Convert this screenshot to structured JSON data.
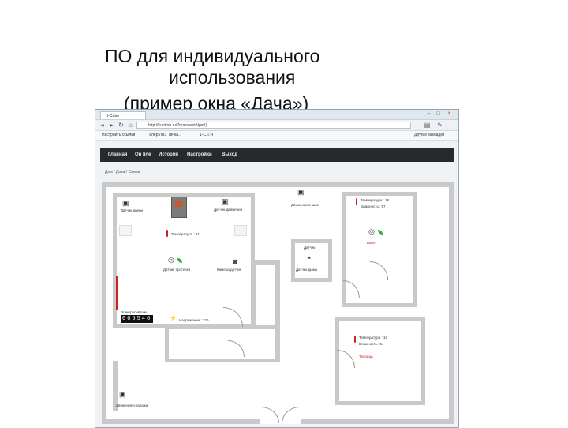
{
  "slide": {
    "title_line1": "ПО для индивидуального",
    "title_line2": "использования",
    "title_line3": "(пример окна «Дача»)"
  },
  "browser": {
    "tab_title": "I-Cube",
    "url": "http://kubtron.ru/?main=ext&lp=1)",
    "bookmarks": [
      "Настроить ссылки",
      "Гипер ЛВЗ Тачка...",
      "1-С.Т.Я"
    ],
    "other_bookmarks": "Другие закладки"
  },
  "menu": {
    "items": [
      "Главная",
      "On line",
      "История",
      "Настройки",
      "Выход"
    ]
  },
  "breadcrumb": "Дом / Дача / Схема",
  "plan": {
    "labels": {
      "sensor_door_left": "Датчик двери",
      "sensor_motion_top": "Датчик движения",
      "motion_sensor_hall": "Движение в зале",
      "temp_main": "Температура : 21",
      "temp_right_top": "Температура : 18",
      "humidity_right_top": "Влажность : 57",
      "bath": "Баня",
      "smoke_sensor": "Датчик протечки",
      "camera_sensor": "Камера/датчик",
      "smoke_center": "Датчик",
      "smoke_center_sub": "Датчик дыма",
      "power_counter": "Электросчётчик",
      "counter_value": "005546",
      "power_usage": "Напряжение : 220",
      "temp_right_bottom": "Температура : 16",
      "humidity_right_bottom": "Влажность : 64",
      "garage_motion": "Движение у гаража",
      "bottom_right_label": "Теплица"
    }
  },
  "colors": {
    "menu_bg": "#262a2e",
    "wall": "#c9c9c9",
    "accent_red": "#c22",
    "leaf_green": "#2aa84a"
  }
}
